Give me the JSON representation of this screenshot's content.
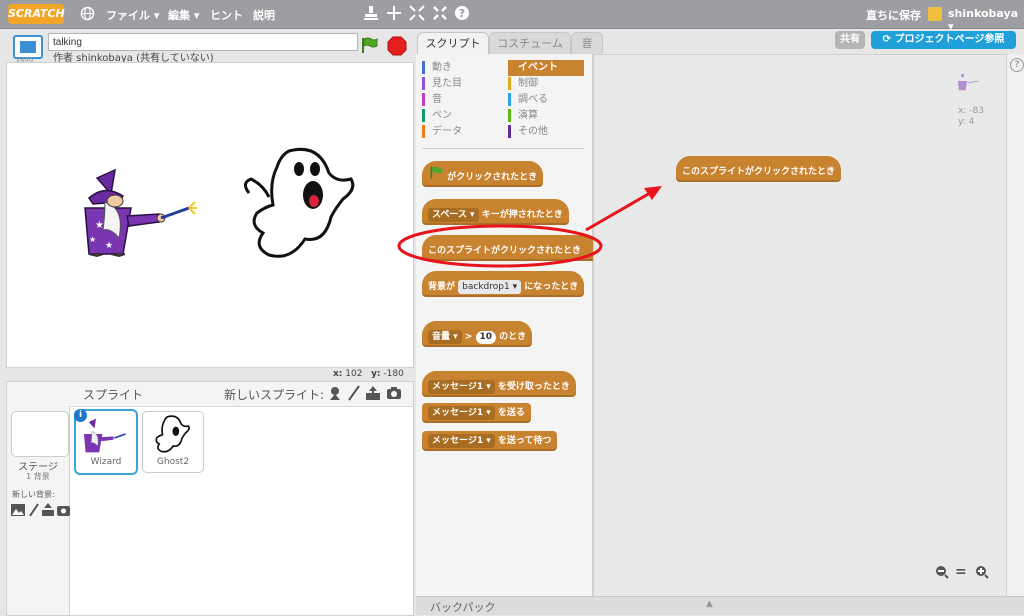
{
  "menu": {
    "logo": "SCRATCH",
    "items": [
      "ファイル ▾",
      "編集 ▾",
      "ヒント",
      "説明"
    ],
    "save_now": "直ちに保存",
    "user": "shinkobaya ▾"
  },
  "stage": {
    "version": "v446",
    "title_value": "talking",
    "author": "作者 shinkobaya (共有していない)",
    "coords": {
      "x_label": "x:",
      "x": "102",
      "y_label": "y:",
      "y": "-180"
    }
  },
  "sprites": {
    "header": "スプライト",
    "new_sprite": "新しいスプライト:",
    "stage_label": "ステージ",
    "stage_count": "1 背景",
    "new_backdrop": "新しい背景:",
    "list": [
      {
        "name": "Wizard"
      },
      {
        "name": "Ghost2"
      }
    ]
  },
  "tabs": [
    "スクリプト",
    "コスチューム",
    "音"
  ],
  "palette": {
    "categories_left": [
      {
        "label": "動き",
        "color": "#4a6cd4"
      },
      {
        "label": "見た目",
        "color": "#8a55d7"
      },
      {
        "label": "音",
        "color": "#bb42c3"
      },
      {
        "label": "ペン",
        "color": "#0e9a6c"
      },
      {
        "label": "データ",
        "color": "#ee7d16"
      }
    ],
    "categories_right": [
      {
        "label": "イベント",
        "color": "#c88330",
        "selected": true
      },
      {
        "label": "制御",
        "color": "#e1a91a"
      },
      {
        "label": "調べる",
        "color": "#2ca5e2"
      },
      {
        "label": "演算",
        "color": "#5cb712"
      },
      {
        "label": "その他",
        "color": "#632d99"
      }
    ],
    "blocks": {
      "flag_clicked": "がクリックされたとき",
      "key_pressed_key": "スペース",
      "key_pressed_text": "キーが押されたとき",
      "sprite_clicked": "このスプライトがクリックされたとき",
      "backdrop_prefix": "背景が",
      "backdrop_value": "backdrop1",
      "backdrop_suffix": "になったとき",
      "sensor_value": "音量",
      "sensor_gt": ">",
      "sensor_num": "10",
      "sensor_suffix": "のとき",
      "receive_msg": "メッセージ1",
      "receive_text": "を受け取ったとき",
      "broadcast_msg": "メッセージ1",
      "broadcast_text": "を送る",
      "broadcast_wait_msg": "メッセージ1",
      "broadcast_wait_text": "を送って待つ"
    }
  },
  "scripts": {
    "share_button": "共有",
    "project_page_button": "プロジェクトページ参照",
    "placed_block": "このスプライトがクリックされたとき",
    "sprite_x": "x: -83",
    "sprite_y": "y: 4"
  },
  "backpack": "バックパック",
  "colors": {
    "accent": "#1fa0d8",
    "event": "#c88330",
    "annotation": "#e8141c"
  }
}
